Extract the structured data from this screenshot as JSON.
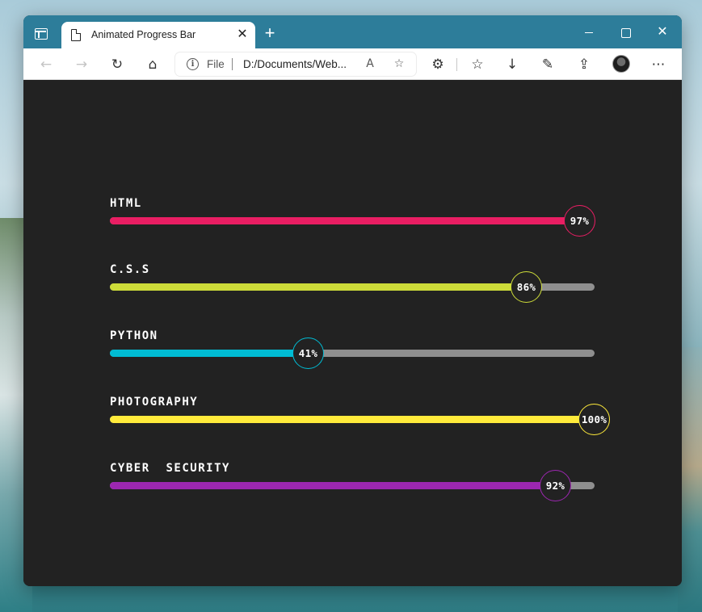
{
  "browser": {
    "tab_title": "Animated Progress Bar",
    "tab_close_glyph": "✕",
    "new_tab_glyph": "+",
    "window_close_glyph": "✕",
    "address": {
      "scheme_label": "File",
      "url": "D:/Documents/Web..."
    },
    "icons": [
      "tab-actions-icon",
      "page-icon",
      "back-icon",
      "forward-icon",
      "refresh-icon",
      "home-icon",
      "info-icon",
      "read-aloud-icon",
      "add-favorite-icon",
      "extensions-icon",
      "favorites-icon",
      "downloads-icon",
      "web-capture-icon",
      "share-icon",
      "profile-avatar",
      "more-icon"
    ]
  },
  "skills": [
    {
      "name": "HTML",
      "percent_label": "97%",
      "value": 97,
      "color": "#e91e63"
    },
    {
      "name": "C.S.S",
      "percent_label": "86%",
      "value": 86,
      "color": "#cddc39"
    },
    {
      "name": "Python",
      "percent_label": "41%",
      "value": 41,
      "color": "#00bcd4"
    },
    {
      "name": "Photography",
      "percent_label": "100%",
      "value": 100,
      "color": "#ffeb3b"
    },
    {
      "name": "Cyber  Security",
      "percent_label": "92%",
      "value": 92,
      "color": "#9c27b0"
    }
  ],
  "track_color": "#8f8f8f",
  "background_color": "#222222",
  "titlebar_color": "#2d7d9a"
}
